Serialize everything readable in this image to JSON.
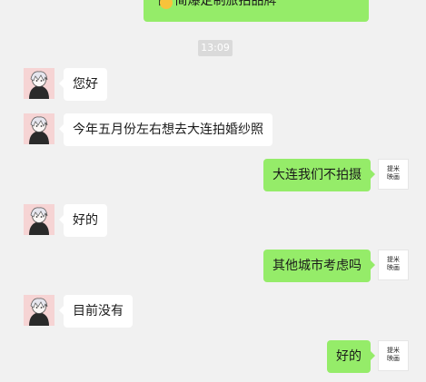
{
  "top_message": {
    "text": "图 简爆定制旅拍品牌",
    "direction": "out"
  },
  "timestamp": "13:09",
  "messages": [
    {
      "direction": "in",
      "text": "您好"
    },
    {
      "direction": "in",
      "text": "今年五月份左右想去大连拍婚纱照"
    },
    {
      "direction": "out",
      "text": "大连我们不拍摄"
    },
    {
      "direction": "in",
      "text": "好的"
    },
    {
      "direction": "out",
      "text": "其他城市考虑吗"
    },
    {
      "direction": "in",
      "text": "目前没有"
    },
    {
      "direction": "out",
      "text": "好的"
    }
  ],
  "self_avatar": {
    "line1": "提米",
    "line2": "映画"
  },
  "colors": {
    "background": "#f1f1f1",
    "incoming_bubble": "#ffffff",
    "outgoing_bubble": "#95ec69",
    "timestamp_bg": "#dadada"
  }
}
